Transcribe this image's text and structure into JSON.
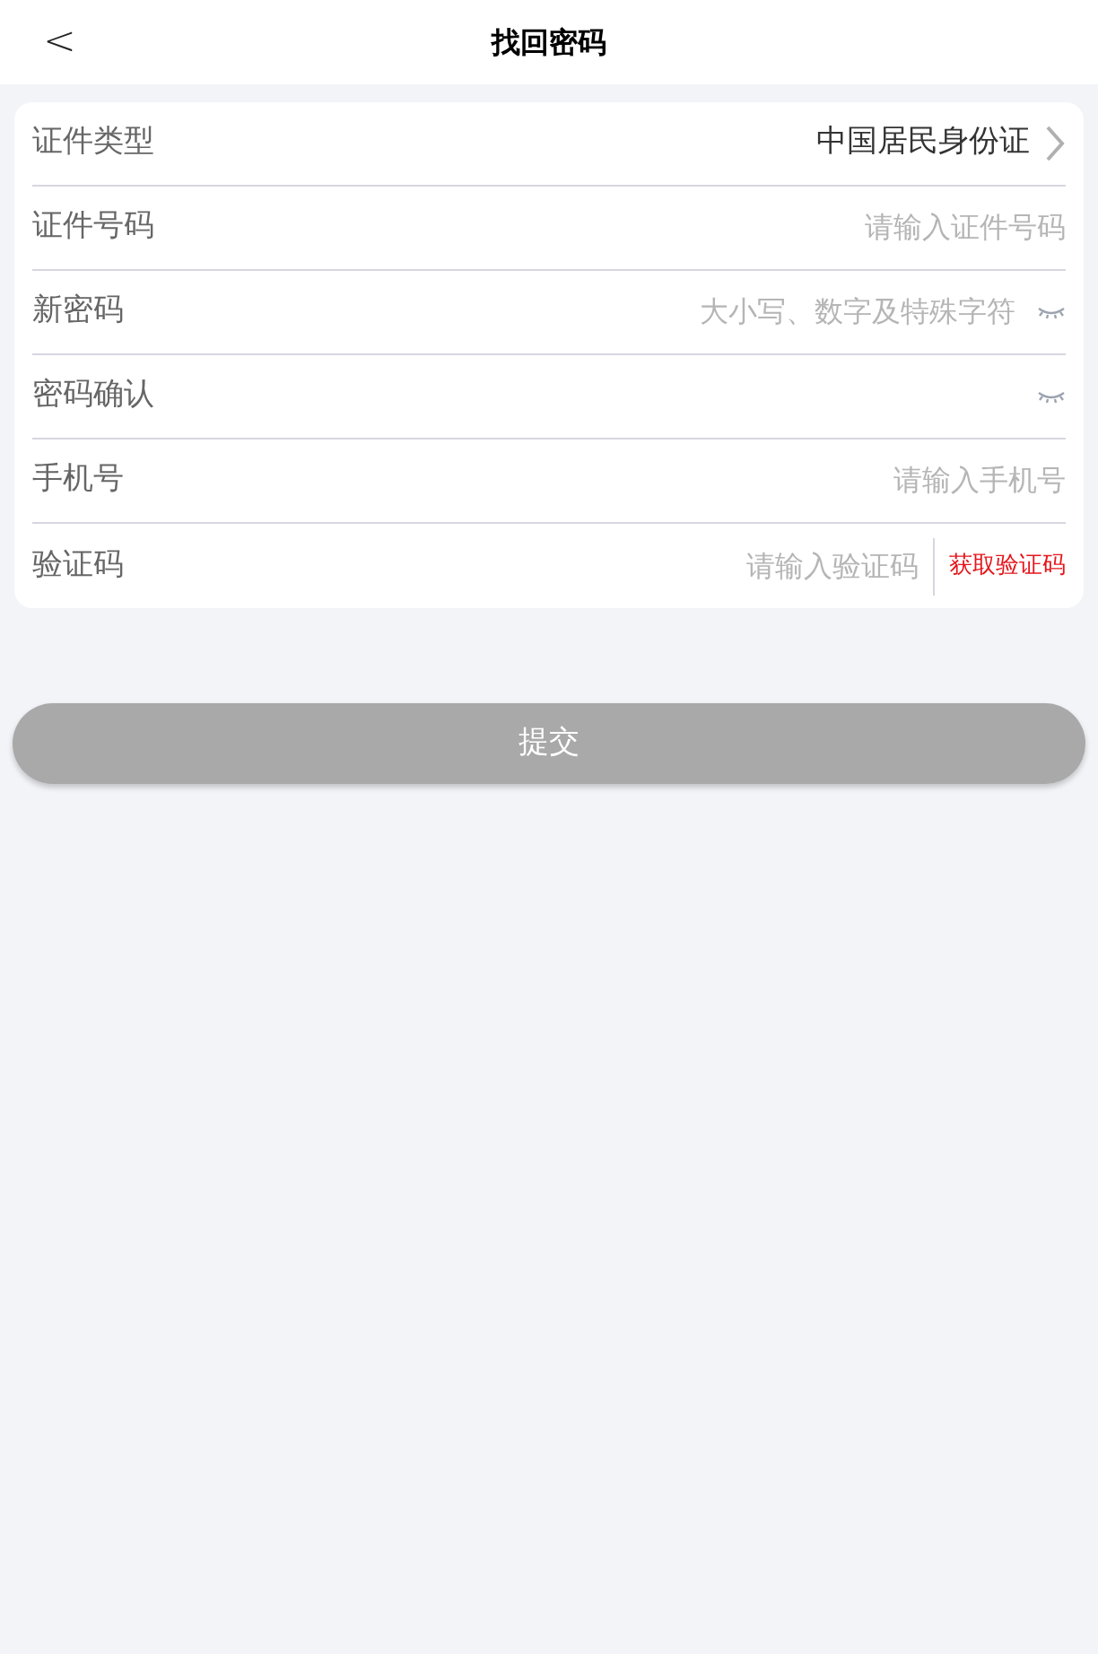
{
  "header": {
    "back": "<",
    "title": "找回密码"
  },
  "rows": [
    {
      "kind": "select",
      "label": "证件类型",
      "value": "中国居民身份证"
    },
    {
      "kind": "input",
      "label": "证件号码",
      "placeholder": "请输入证件号码"
    },
    {
      "kind": "password",
      "label": "新密码",
      "placeholder": "大小写、数字及特殊字符"
    },
    {
      "kind": "password",
      "label": "密码确认"
    },
    {
      "kind": "input",
      "label": "手机号",
      "placeholder": "请输入手机号"
    },
    {
      "kind": "code",
      "label": "验证码",
      "placeholder": "请输入验证码",
      "action": "获取验证码"
    }
  ],
  "submit": {
    "label": "提交",
    "disabled": true
  }
}
